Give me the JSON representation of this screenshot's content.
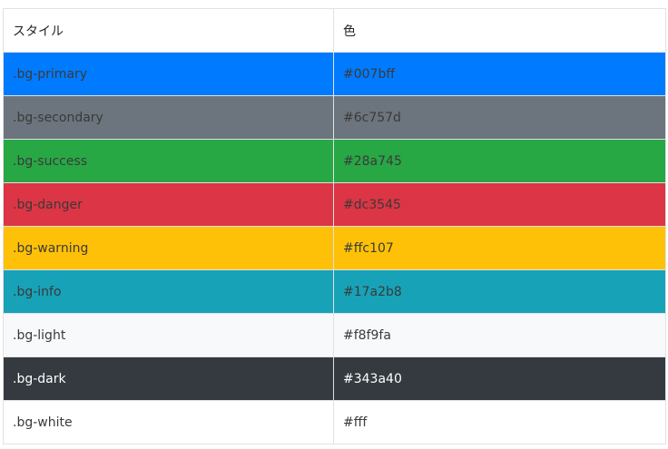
{
  "table": {
    "headers": [
      "スタイル",
      "色"
    ],
    "rows": [
      {
        "style": ".bg-primary",
        "color": "#007bff",
        "bg": "#007bff",
        "text": "#3a3a3a"
      },
      {
        "style": ".bg-secondary",
        "color": "#6c757d",
        "bg": "#6c757d",
        "text": "#3a3a3a"
      },
      {
        "style": ".bg-success",
        "color": "#28a745",
        "bg": "#28a745",
        "text": "#3a3a3a"
      },
      {
        "style": ".bg-danger",
        "color": "#dc3545",
        "bg": "#dc3545",
        "text": "#3a3a3a"
      },
      {
        "style": ".bg-warning",
        "color": "#ffc107",
        "bg": "#ffc107",
        "text": "#3a3a3a"
      },
      {
        "style": ".bg-info",
        "color": "#17a2b8",
        "bg": "#17a2b8",
        "text": "#3a3a3a"
      },
      {
        "style": ".bg-light",
        "color": "#f8f9fa",
        "bg": "#f8f9fa",
        "text": "#3a3a3a"
      },
      {
        "style": ".bg-dark",
        "color": "#343a40",
        "bg": "#343a40",
        "text": "#ffffff"
      },
      {
        "style": ".bg-white",
        "color": "#fff",
        "bg": "#ffffff",
        "text": "#3a3a3a"
      }
    ]
  }
}
